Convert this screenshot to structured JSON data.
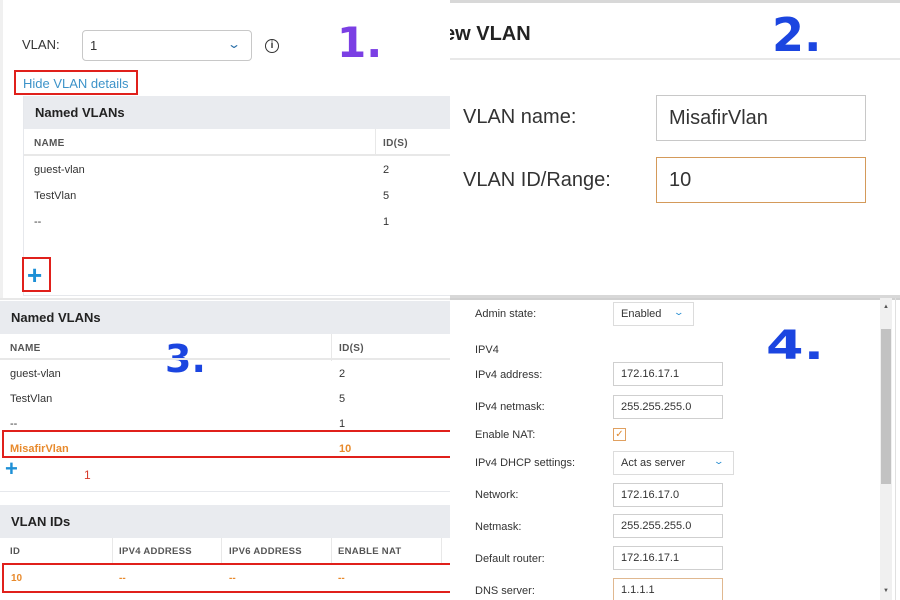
{
  "step_labels": [
    "1.",
    "2.",
    "3.",
    "4."
  ],
  "step_colors": {
    "step1": "#7b3fe4",
    "step2": "#1b45e0",
    "step3": "#1b45e0",
    "step4": "#1b45e0"
  },
  "highlight_color": "#e0201b",
  "accent_orange": "#e88a2c",
  "panel1": {
    "vlan_label": "VLAN:",
    "vlan_select_value": "1",
    "hide_details_link": "Hide VLAN details",
    "named_vlans": {
      "title": "Named VLANs",
      "columns": [
        "NAME",
        "ID(S)"
      ],
      "rows": [
        {
          "name": "guest-vlan",
          "ids": "2"
        },
        {
          "name": "TestVlan",
          "ids": "5"
        },
        {
          "name": "--",
          "ids": "1"
        }
      ]
    },
    "add_button": "+"
  },
  "panel2": {
    "title": "ew VLAN",
    "fields": [
      {
        "label": "VLAN name:",
        "value": "MisafirVlan"
      },
      {
        "label": "VLAN ID/Range:",
        "value": "10"
      }
    ]
  },
  "panel3": {
    "named_vlans": {
      "title": "Named VLANs",
      "columns": [
        "NAME",
        "ID(S)"
      ],
      "rows": [
        {
          "name": "guest-vlan",
          "ids": "2"
        },
        {
          "name": "TestVlan",
          "ids": "5"
        },
        {
          "name": "--",
          "ids": "1"
        },
        {
          "name": "MisafirVlan",
          "ids": "10"
        }
      ]
    },
    "add_button": "+",
    "annotation": "1",
    "vlan_ids": {
      "title": "VLAN IDs",
      "columns": [
        "ID",
        "IPV4 ADDRESS",
        "IPV6 ADDRESS",
        "ENABLE NAT"
      ],
      "rows": [
        {
          "id": "10",
          "ipv4": "--",
          "ipv6": "--",
          "nat": "--"
        }
      ]
    }
  },
  "panel4": {
    "admin_state": {
      "label": "Admin state:",
      "value": "Enabled"
    },
    "section": "IPV4",
    "ipv4_address": {
      "label": "IPv4 address:",
      "value": "172.16.17.1"
    },
    "ipv4_netmask": {
      "label": "IPv4 netmask:",
      "value": "255.255.255.0"
    },
    "enable_nat": {
      "label": "Enable NAT:",
      "checked": true
    },
    "dhcp_settings": {
      "label": "IPv4 DHCP settings:",
      "value": "Act as server"
    },
    "network": {
      "label": "Network:",
      "value": "172.16.17.0"
    },
    "netmask": {
      "label": "Netmask:",
      "value": "255.255.255.0"
    },
    "default_router": {
      "label": "Default router:",
      "value": "172.16.17.1"
    },
    "dns_server": {
      "label": "DNS server:",
      "value": "1.1.1.1"
    }
  }
}
